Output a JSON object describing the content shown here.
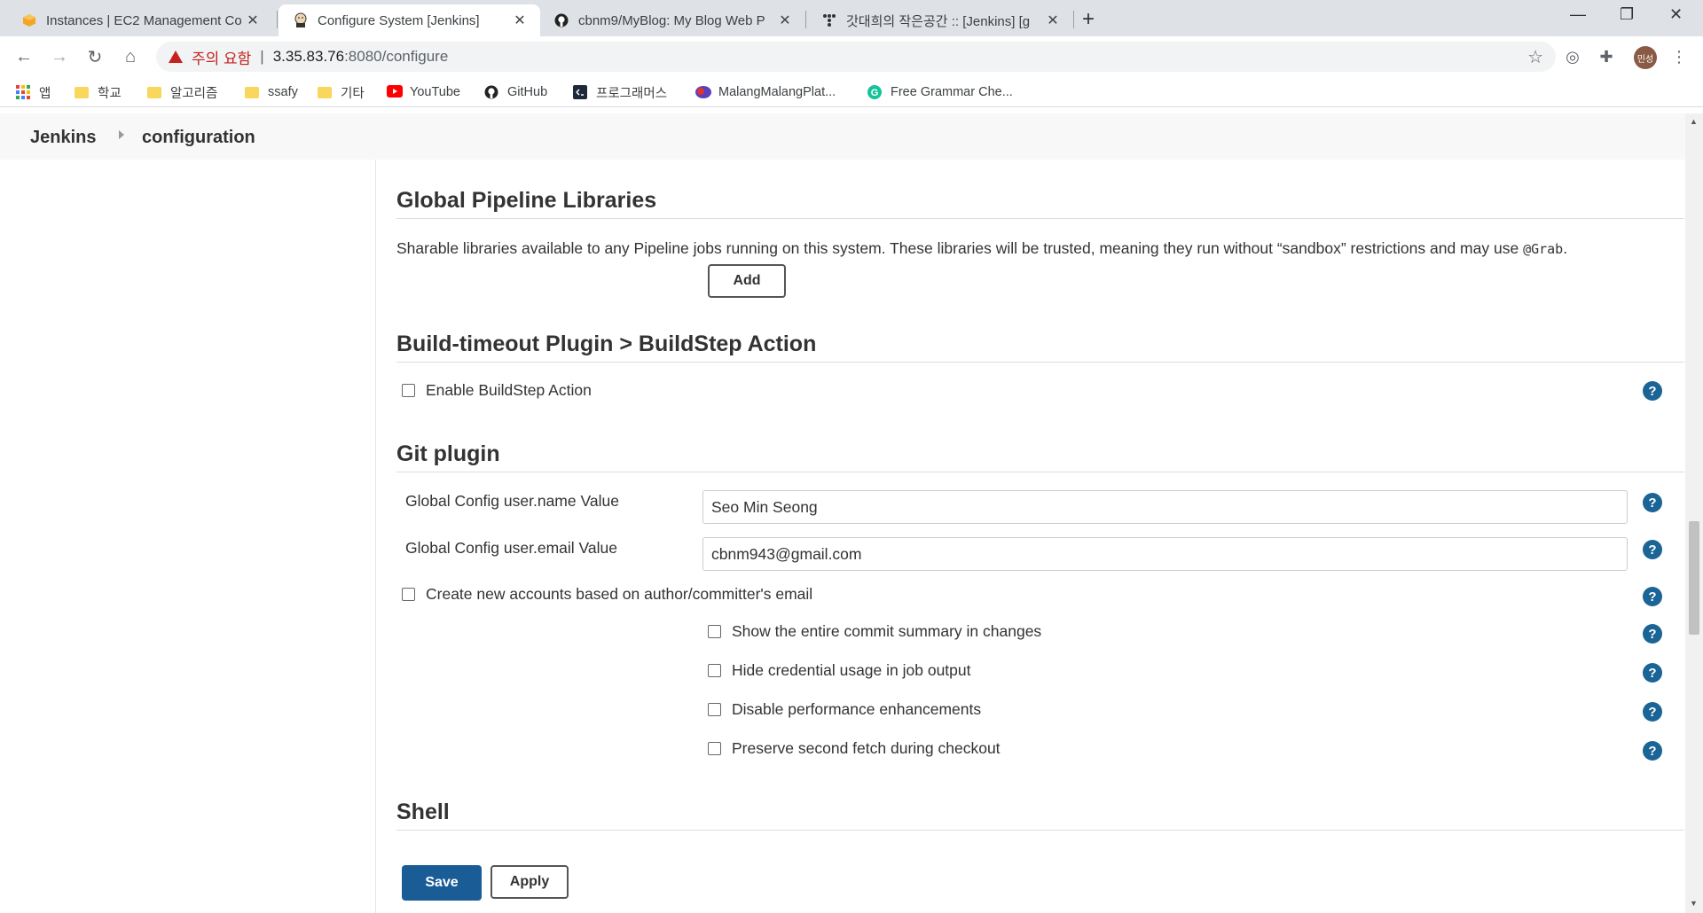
{
  "browser": {
    "tabs": [
      {
        "title": "Instances | EC2 Management Co",
        "active": false
      },
      {
        "title": "Configure System [Jenkins]",
        "active": true
      },
      {
        "title": "cbnm9/MyBlog: My Blog Web P",
        "active": false
      },
      {
        "title": "갓대희의 작은공간 :: [Jenkins] [g",
        "active": false
      }
    ],
    "security_warning": "주의 요함",
    "url_host": "3.35.83.76",
    "url_path": ":8080/configure",
    "profile_initials": "민성",
    "bookmarks": [
      {
        "label": "앱",
        "icon": "apps-grid-icon"
      },
      {
        "label": "학교",
        "icon": "folder-icon"
      },
      {
        "label": "알고리즘",
        "icon": "folder-icon"
      },
      {
        "label": "ssafy",
        "icon": "folder-icon"
      },
      {
        "label": "기타",
        "icon": "folder-icon"
      },
      {
        "label": "YouTube",
        "icon": "youtube-icon"
      },
      {
        "label": "GitHub",
        "icon": "github-icon"
      },
      {
        "label": "프로그래머스",
        "icon": "programmers-icon"
      },
      {
        "label": "MalangMalangPlat...",
        "icon": "malang-icon"
      },
      {
        "label": "Free Grammar Che...",
        "icon": "grammarly-icon"
      }
    ]
  },
  "jenkins": {
    "breadcrumb": {
      "root": "Jenkins",
      "current": "configuration"
    },
    "sections": {
      "pipeline": {
        "title": "Global Pipeline Libraries",
        "description_pre": "Sharable libraries available to any Pipeline jobs running on this system. These libraries will be trusted, meaning they run without “sandbox” restrictions and may use ",
        "description_code": "@Grab",
        "description_post": ".",
        "add_label": "Add"
      },
      "build_timeout": {
        "title": "Build-timeout Plugin > BuildStep Action",
        "enable_label": "Enable BuildStep Action"
      },
      "git": {
        "title": "Git plugin",
        "name_label": "Global Config user.name Value",
        "name_value": "Seo Min Seong",
        "email_label": "Global Config user.email Value",
        "email_value": "cbnm943@gmail.com",
        "create_accounts_label": "Create new accounts based on author/committer's email",
        "show_summary_label": "Show the entire commit summary in changes",
        "hide_credential_label": "Hide credential usage in job output",
        "disable_perf_label": "Disable performance enhancements",
        "preserve_fetch_label": "Preserve second fetch during checkout"
      },
      "shell": {
        "title": "Shell"
      }
    },
    "buttons": {
      "save": "Save",
      "apply": "Apply"
    }
  },
  "colors": {
    "primary_button": "#1a5d96",
    "help_icon": "#1a6496",
    "warning": "#c5221f"
  }
}
